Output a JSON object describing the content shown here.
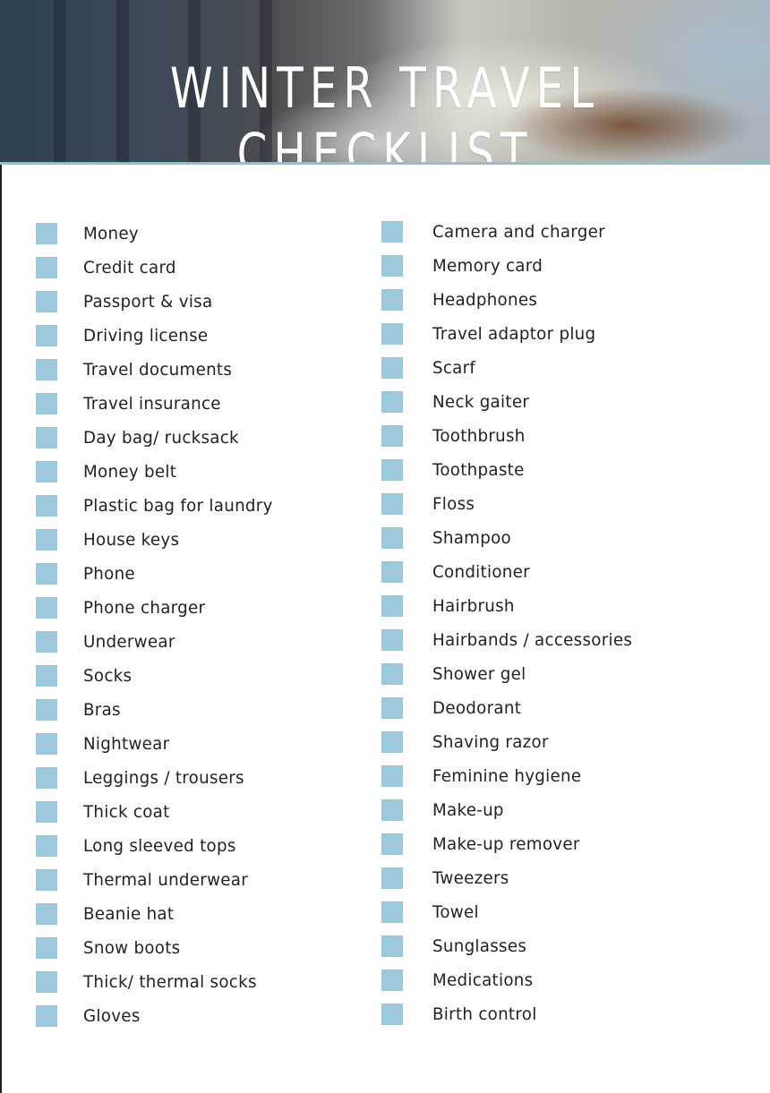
{
  "title": "WINTER TRAVEL CHECKLIST",
  "colors": {
    "checkbox": "#9dc8dc",
    "text": "#222226",
    "title": "#ffffff",
    "header_rule": "#8fc1d2"
  },
  "left_column": [
    {
      "label": "Money",
      "checked": false
    },
    {
      "label": "Credit card",
      "checked": false
    },
    {
      "label": "Passport & visa",
      "checked": false
    },
    {
      "label": "Driving license",
      "checked": false
    },
    {
      "label": "Travel documents",
      "checked": false
    },
    {
      "label": "Travel insurance",
      "checked": false
    },
    {
      "label": "Day bag/ rucksack",
      "checked": false
    },
    {
      "label": "Money belt",
      "checked": false
    },
    {
      "label": "Plastic bag for laundry",
      "checked": false
    },
    {
      "label": "House keys",
      "checked": false
    },
    {
      "label": "Phone",
      "checked": false
    },
    {
      "label": "Phone charger",
      "checked": false
    },
    {
      "label": "Underwear",
      "checked": false
    },
    {
      "label": "Socks",
      "checked": false
    },
    {
      "label": "Bras",
      "checked": false
    },
    {
      "label": "Nightwear",
      "checked": false
    },
    {
      "label": "Leggings / trousers",
      "checked": false
    },
    {
      "label": "Thick coat",
      "checked": false
    },
    {
      "label": "Long sleeved tops",
      "checked": false
    },
    {
      "label": "Thermal underwear",
      "checked": false
    },
    {
      "label": "Beanie hat",
      "checked": false
    },
    {
      "label": "Snow boots",
      "checked": false
    },
    {
      "label": "Thick/ thermal socks",
      "checked": false
    },
    {
      "label": "Gloves",
      "checked": false
    }
  ],
  "right_column": [
    {
      "label": "Camera and charger",
      "checked": false
    },
    {
      "label": "Memory card",
      "checked": false
    },
    {
      "label": "Headphones",
      "checked": false
    },
    {
      "label": "Travel adaptor plug",
      "checked": false
    },
    {
      "label": "Scarf",
      "checked": false
    },
    {
      "label": "Neck gaiter",
      "checked": false
    },
    {
      "label": "Toothbrush",
      "checked": false
    },
    {
      "label": "Toothpaste",
      "checked": false
    },
    {
      "label": "Floss",
      "checked": false
    },
    {
      "label": "Shampoo",
      "checked": false
    },
    {
      "label": "Conditioner",
      "checked": false
    },
    {
      "label": "Hairbrush",
      "checked": false
    },
    {
      "label": "Hairbands / accessories",
      "checked": false
    },
    {
      "label": "Shower gel",
      "checked": false
    },
    {
      "label": "Deodorant",
      "checked": false
    },
    {
      "label": "Shaving razor",
      "checked": false
    },
    {
      "label": "Feminine hygiene",
      "checked": false
    },
    {
      "label": "Make-up",
      "checked": false
    },
    {
      "label": "Make-up remover",
      "checked": false
    },
    {
      "label": "Tweezers",
      "checked": false
    },
    {
      "label": "Towel",
      "checked": false
    },
    {
      "label": "Sunglasses",
      "checked": false
    },
    {
      "label": "Medications",
      "checked": false
    },
    {
      "label": "Birth control",
      "checked": false
    }
  ]
}
